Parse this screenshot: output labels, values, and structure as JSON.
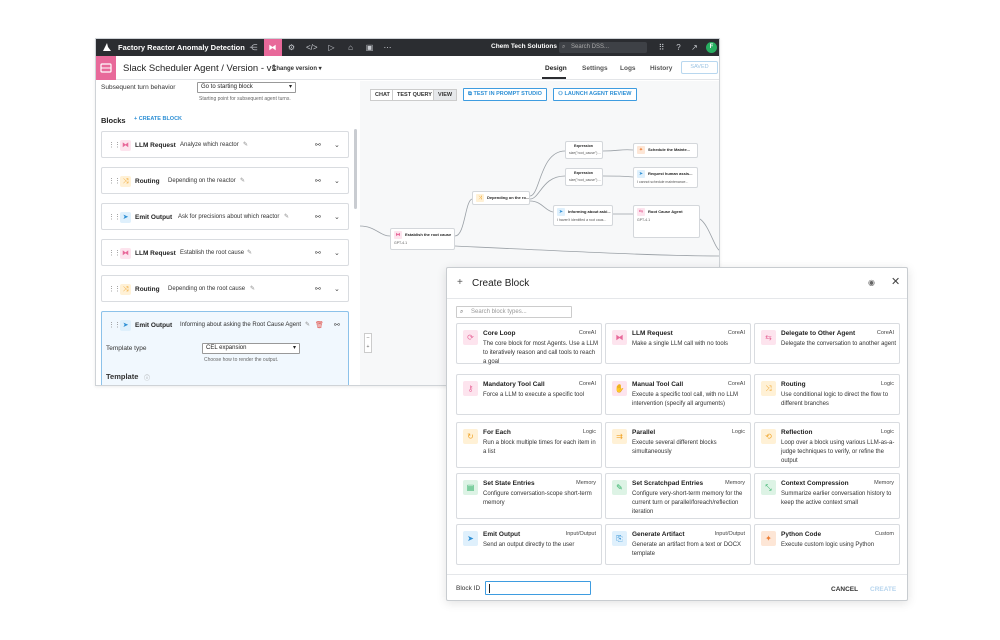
{
  "topbar": {
    "project": "Factory Reactor Anomaly Detection",
    "org": "Chem Tech Solutions",
    "search_placeholder": "Search DSS...",
    "avatar": "F"
  },
  "subbar": {
    "title": "Slack Scheduler Agent  /  Version - v1",
    "change_version": "Change version",
    "tabs": [
      "Design",
      "Settings",
      "Logs",
      "History"
    ],
    "saved": "SAVED"
  },
  "leftpanel": {
    "subsequent_label": "Subsequent turn behavior",
    "subsequent_value": "Go to starting block",
    "subsequent_hint": "Starting point for subsequent agent turns.",
    "blocks_heading": "Blocks",
    "create_block": "+ CREATE BLOCK",
    "blocks": [
      {
        "name": "LLM Request",
        "desc": "Analyze which reactor",
        "icon": "llm-icon"
      },
      {
        "name": "Routing",
        "desc": "Depending on the reactor",
        "icon": "routing-icon"
      },
      {
        "name": "Emit Output",
        "desc": "Ask for precisions about which reactor",
        "icon": "emit-icon"
      },
      {
        "name": "LLM Request",
        "desc": "Establish the root cause",
        "icon": "llm-icon"
      },
      {
        "name": "Routing",
        "desc": "Depending on the root cause",
        "icon": "routing-icon"
      },
      {
        "name": "Emit Output",
        "desc": "Informing about asking the Root Cause Agent",
        "icon": "emit-icon"
      }
    ],
    "template_type_label": "Template type",
    "template_type_value": "CEL expansion",
    "template_type_hint": "Choose how to render the output.",
    "template_heading": "Template"
  },
  "canvas": {
    "segments": [
      "CHAT",
      "TEST QUERY",
      "VIEW"
    ],
    "test_prompt": "TEST IN PROMPT STUDIO",
    "launch_review": "LAUNCH AGENT REVIEW",
    "nodes": {
      "establish": {
        "title": "Establish the root cause",
        "sub": "GPT-4.1"
      },
      "depending": {
        "title": "Depending on the ro..."
      },
      "expr1": {
        "title": "Expression",
        "sub": "size(\"root_cause\") ..."
      },
      "expr2": {
        "title": "Expression",
        "sub": "size(\"root_cause\") ..."
      },
      "schedule": {
        "title": "Schedule the Mainte..."
      },
      "request": {
        "title": "Request human assis...",
        "sub": "I cannot schedule maintenance..."
      },
      "informing": {
        "title": "Informing about aski...",
        "sub": "I haven't identified a root caus..."
      },
      "rootcause": {
        "title": "Root Cause Agent",
        "sub": "GPT-4.1"
      }
    }
  },
  "modal": {
    "title": "Create Block",
    "search_placeholder": "Search block types...",
    "cards": [
      {
        "name": "Core Loop",
        "cat": "CoreAI",
        "desc": "The core block for most Agents. Use a LLM to iteratively reason and call tools to reach a goal",
        "icon": "loop-icon"
      },
      {
        "name": "LLM Request",
        "cat": "CoreAI",
        "desc": "Make a single LLM call with no tools",
        "icon": "llm-icon"
      },
      {
        "name": "Delegate to Other Agent",
        "cat": "CoreAI",
        "desc": "Delegate the conversation to another agent",
        "icon": "delegate-icon"
      },
      {
        "name": "Mandatory Tool Call",
        "cat": "CoreAI",
        "desc": "Force a LLM to execute a specific tool",
        "icon": "tool-icon"
      },
      {
        "name": "Manual Tool Call",
        "cat": "CoreAI",
        "desc": "Execute a specific tool call, with no LLM intervention (specify all arguments)",
        "icon": "hand-icon"
      },
      {
        "name": "Routing",
        "cat": "Logic",
        "desc": "Use conditional logic to direct the flow to different branches",
        "icon": "routing-icon"
      },
      {
        "name": "For Each",
        "cat": "Logic",
        "desc": "Run a block multiple times for each item in a list",
        "icon": "foreach-icon"
      },
      {
        "name": "Parallel",
        "cat": "Logic",
        "desc": "Execute several different blocks simultaneously",
        "icon": "parallel-icon"
      },
      {
        "name": "Reflection",
        "cat": "Logic",
        "desc": "Loop over a block using various LLM-as-a-judge techniques to verify, or refine the output",
        "icon": "reflection-icon"
      },
      {
        "name": "Set State Entries",
        "cat": "Memory",
        "desc": "Configure conversation-scope short-term memory",
        "icon": "state-icon"
      },
      {
        "name": "Set Scratchpad Entries",
        "cat": "Memory",
        "desc": "Configure very-short-term memory for the current turn or parallel/foreach/reflection iteration",
        "icon": "scratchpad-icon"
      },
      {
        "name": "Context Compression",
        "cat": "Memory",
        "desc": "Summarize earlier conversation history to keep the active context small",
        "icon": "compress-icon"
      },
      {
        "name": "Emit Output",
        "cat": "Input/Output",
        "desc": "Send an output directly to the user",
        "icon": "emit-icon"
      },
      {
        "name": "Generate Artifact",
        "cat": "Input/Output",
        "desc": "Generate an artifact from a text or DOCX template",
        "icon": "artifact-icon"
      },
      {
        "name": "Python Code",
        "cat": "Custom",
        "desc": "Execute custom logic using Python",
        "icon": "python-icon"
      }
    ],
    "block_id_label": "Block ID",
    "cancel": "CANCEL",
    "create": "CREATE"
  }
}
